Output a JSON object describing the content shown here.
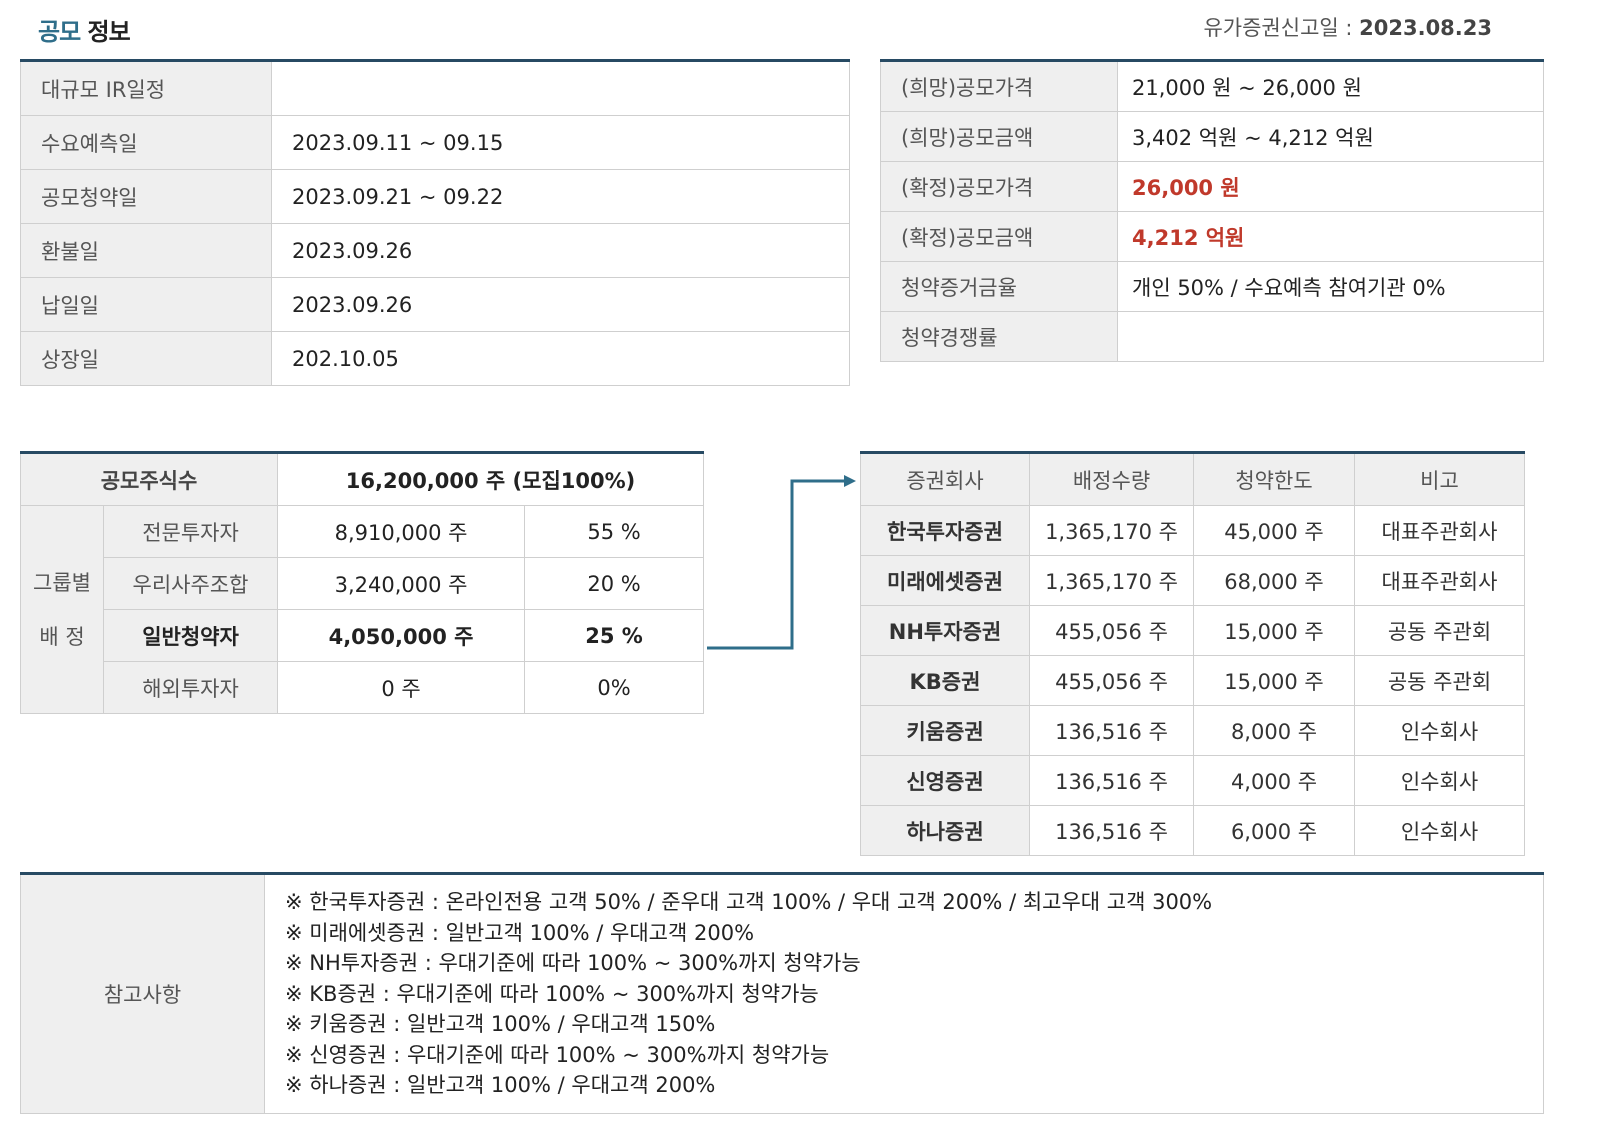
{
  "header": {
    "title_part1": "공모",
    "title_part2": " 정보",
    "filing_label": "유가증권신고일 : ",
    "filing_date": "2023.08.23"
  },
  "schedule": [
    {
      "label": "대규모 IR일정",
      "value": ""
    },
    {
      "label": "수요예측일",
      "value": "2023.09.11 ~ 09.15"
    },
    {
      "label": "공모청약일",
      "value": "2023.09.21 ~ 09.22"
    },
    {
      "label": "환불일",
      "value": "2023.09.26"
    },
    {
      "label": "납일일",
      "value": "2023.09.26"
    },
    {
      "label": "상장일",
      "value": "202.10.05"
    }
  ],
  "pricing": [
    {
      "label": "(희망)공모가격",
      "value": "21,000 원 ~ 26,000 원"
    },
    {
      "label": "(희망)공모금액",
      "value": "3,402 억원  ~ 4,212 억원"
    },
    {
      "label": "(확정)공모가격",
      "value": "26,000 원"
    },
    {
      "label": "(확정)공모금액",
      "value": "4,212 억원"
    },
    {
      "label": "청약증거금율",
      "value": "개인 50% / 수요예측 참여기관 0%"
    },
    {
      "label": "청약경쟁률",
      "value": ""
    }
  ],
  "shares": {
    "header_label": "공모주식수",
    "header_value": "16,200,000 주 (모집100%)",
    "group_label_1": "그룹별",
    "group_label_2": "배 정",
    "rows": [
      {
        "name": "전문투자자",
        "shares": "8,910,000 주",
        "pct": "55 %"
      },
      {
        "name": "우리사주조합",
        "shares": "3,240,000 주",
        "pct": "20 %"
      },
      {
        "name": "일반청약자",
        "shares": "4,050,000 주",
        "pct": "25 %"
      },
      {
        "name": "해외투자자",
        "shares": "0 주",
        "pct": "0%"
      }
    ]
  },
  "brokers": {
    "headers": [
      "증권회사",
      "배정수량",
      "청약한도",
      "비고"
    ],
    "rows": [
      {
        "name": "한국투자증권",
        "alloc": "1,365,170 주",
        "limit": "45,000 주",
        "note": "대표주관회사"
      },
      {
        "name": "미래에셋증권",
        "alloc": "1,365,170 주",
        "limit": "68,000 주",
        "note": "대표주관회사"
      },
      {
        "name": "NH투자증권",
        "alloc": "455,056 주",
        "limit": "15,000 주",
        "note": "공동 주관회"
      },
      {
        "name": "KB증권",
        "alloc": "455,056 주",
        "limit": "15,000 주",
        "note": "공동 주관회"
      },
      {
        "name": "키움증권",
        "alloc": "136,516 주",
        "limit": "8,000 주",
        "note": "인수회사"
      },
      {
        "name": "신영증권",
        "alloc": "136,516 주",
        "limit": "4,000 주",
        "note": "인수회사"
      },
      {
        "name": "하나증권",
        "alloc": "136,516 주",
        "limit": "6,000 주",
        "note": "인수회사"
      }
    ]
  },
  "notes": {
    "label": "참고사항",
    "lines": [
      "※ 한국투자증권 : 온라인전용 고객 50% / 준우대 고객 100% / 우대 고객 200% / 최고우대 고객 300%",
      "※ 미래에셋증권 : 일반고객 100% / 우대고객 200%",
      "※ NH투자증권 : 우대기준에 따라 100% ~ 300%까지 청약가능",
      "※ KB증권 : 우대기준에 따라 100% ~ 300%까지 청약가능",
      "※ 키움증권 : 일반고객 100% / 우대고객 150%",
      "※ 신영증권 : 우대기준에 따라 100% ~ 300%까지 청약가능",
      "※ 하나증권 : 일반고객 100% / 우대고객 200%"
    ]
  },
  "colors": {
    "accent": "#274a63",
    "title_blue": "#2f6e8a",
    "highlight_red": "#c0392b",
    "label_bg": "#efefef",
    "arrow": "#2f6e8a"
  }
}
